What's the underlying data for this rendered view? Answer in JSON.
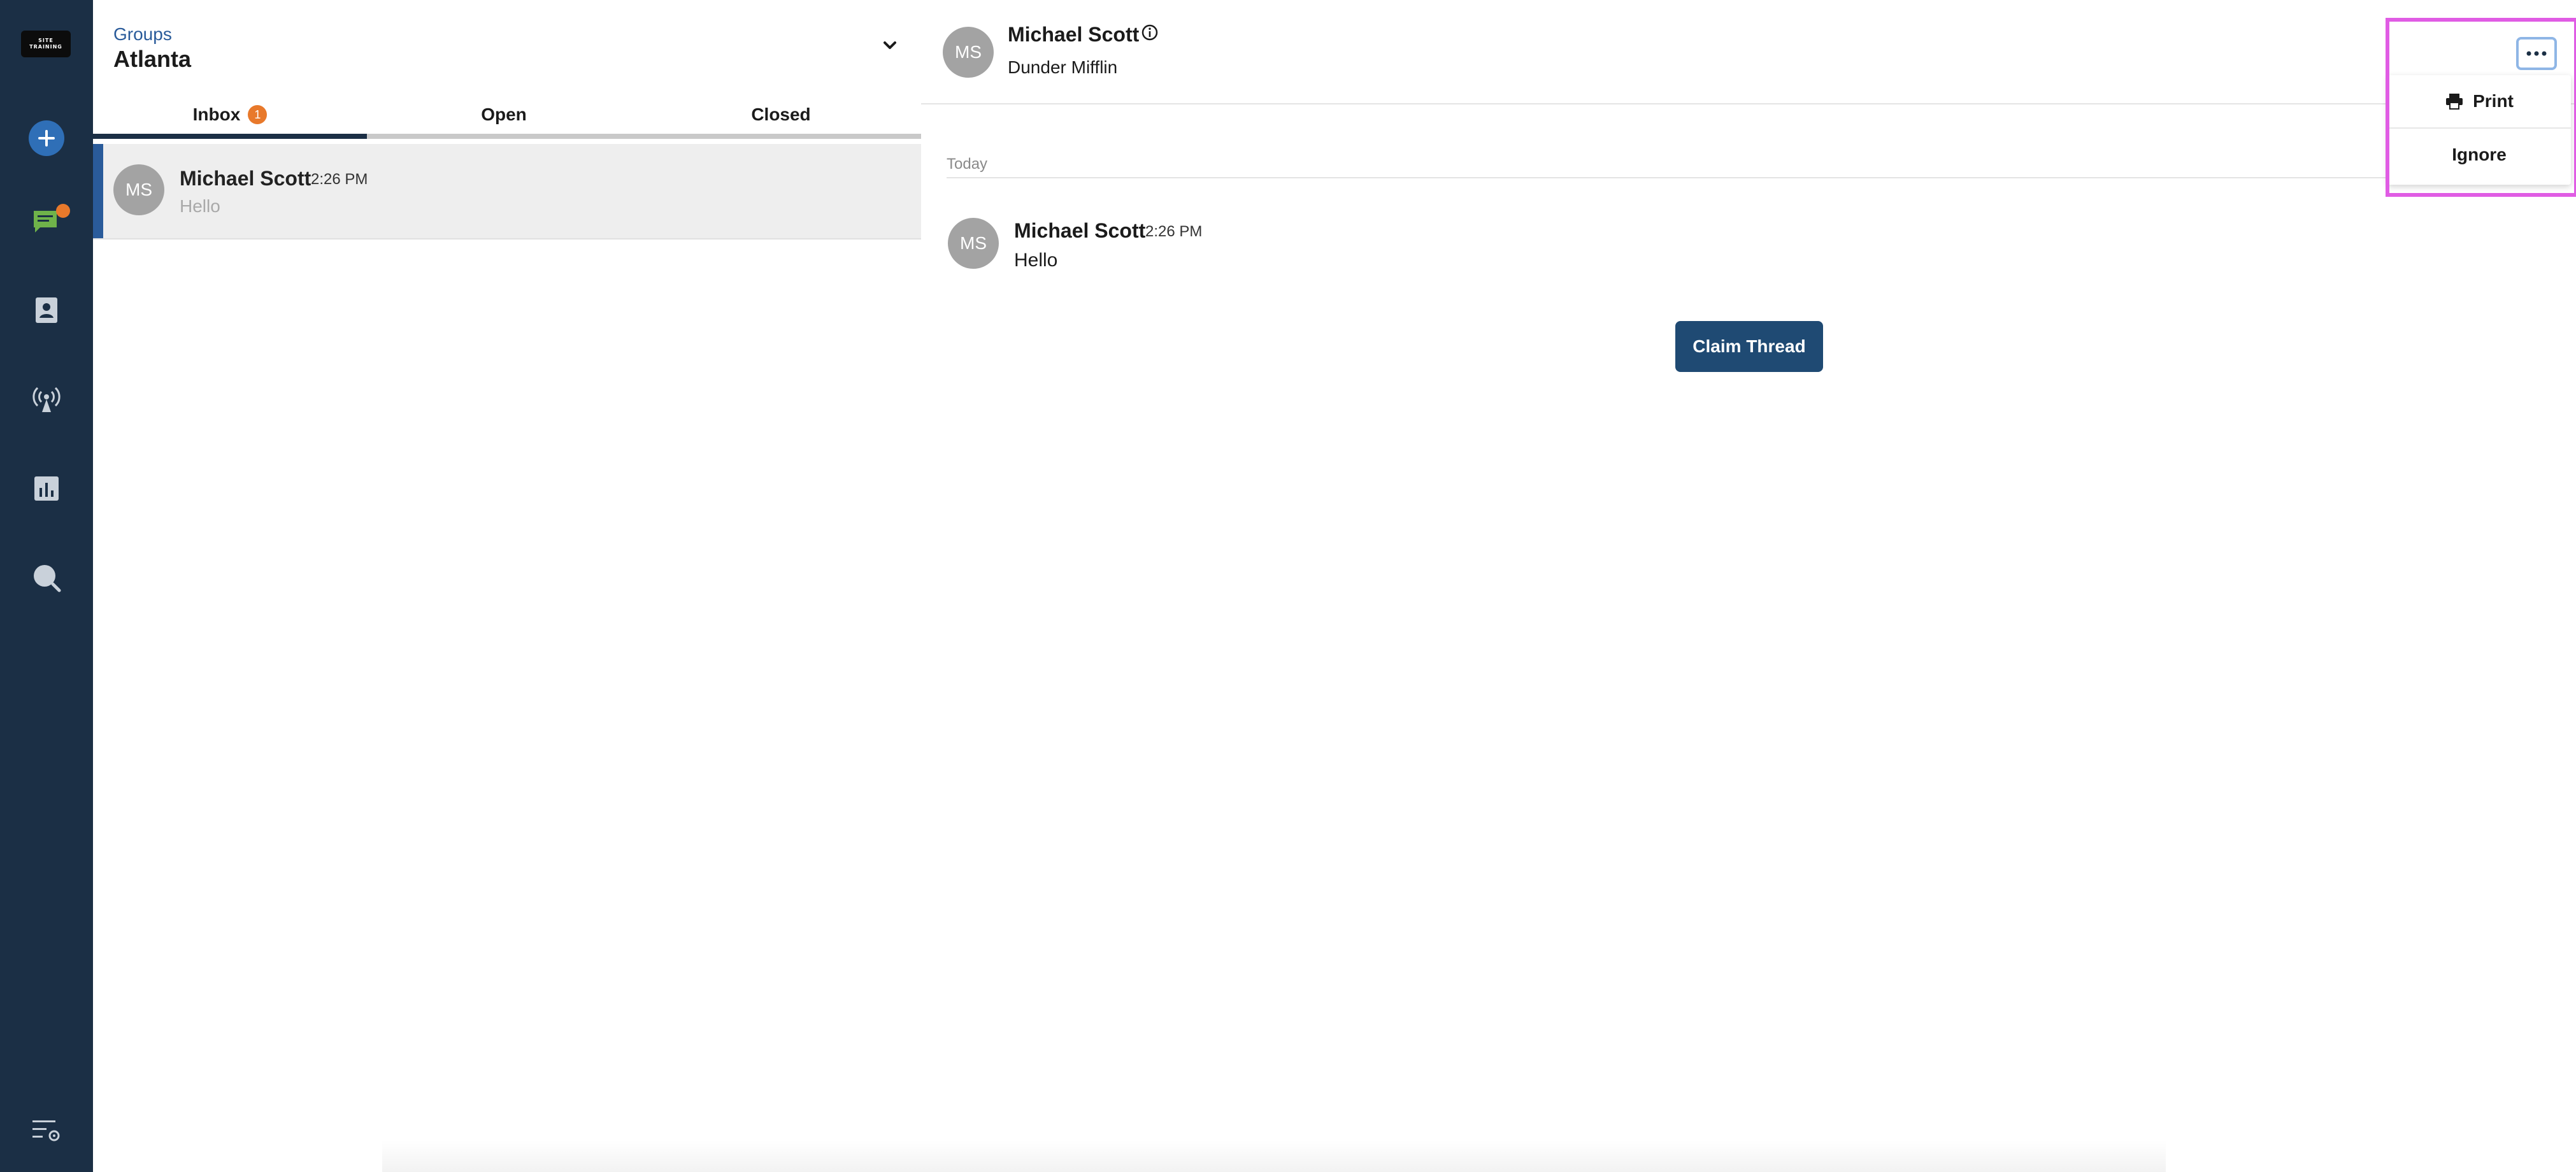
{
  "rail": {
    "logo_text_line1": "SITE",
    "logo_text_line2": "TRAINING",
    "items": [
      {
        "icon": "plus-icon"
      },
      {
        "icon": "chat-icon",
        "has_notification": true
      },
      {
        "icon": "contacts-icon"
      },
      {
        "icon": "broadcast-icon"
      },
      {
        "icon": "analytics-icon"
      },
      {
        "icon": "search-icon"
      },
      {
        "icon": "settings-list-icon"
      }
    ]
  },
  "groups": {
    "label": "Groups",
    "name": "Atlanta"
  },
  "tabs": [
    {
      "label": "Inbox",
      "badge": "1",
      "active": true
    },
    {
      "label": "Open"
    },
    {
      "label": "Closed"
    }
  ],
  "threads": [
    {
      "initials": "MS",
      "name": "Michael Scott",
      "time": "2:26 PM",
      "preview": "Hello"
    }
  ],
  "conversation": {
    "initials": "MS",
    "name": "Michael Scott",
    "organization": "Dunder Mifflin",
    "day_label": "Today",
    "messages": [
      {
        "initials": "MS",
        "name": "Michael Scott",
        "time": "2:26 PM",
        "text": "Hello"
      }
    ],
    "claim_label": "Claim Thread"
  },
  "menu": {
    "items": [
      {
        "label": "Print",
        "icon": "printer-icon"
      },
      {
        "label": "Ignore"
      }
    ]
  },
  "colors": {
    "rail_bg": "#1b2f45",
    "accent_blue": "#2f6fb7",
    "notification_orange": "#e8792b",
    "button_navy": "#1f4a73",
    "highlight_magenta": "#e05ce4"
  }
}
